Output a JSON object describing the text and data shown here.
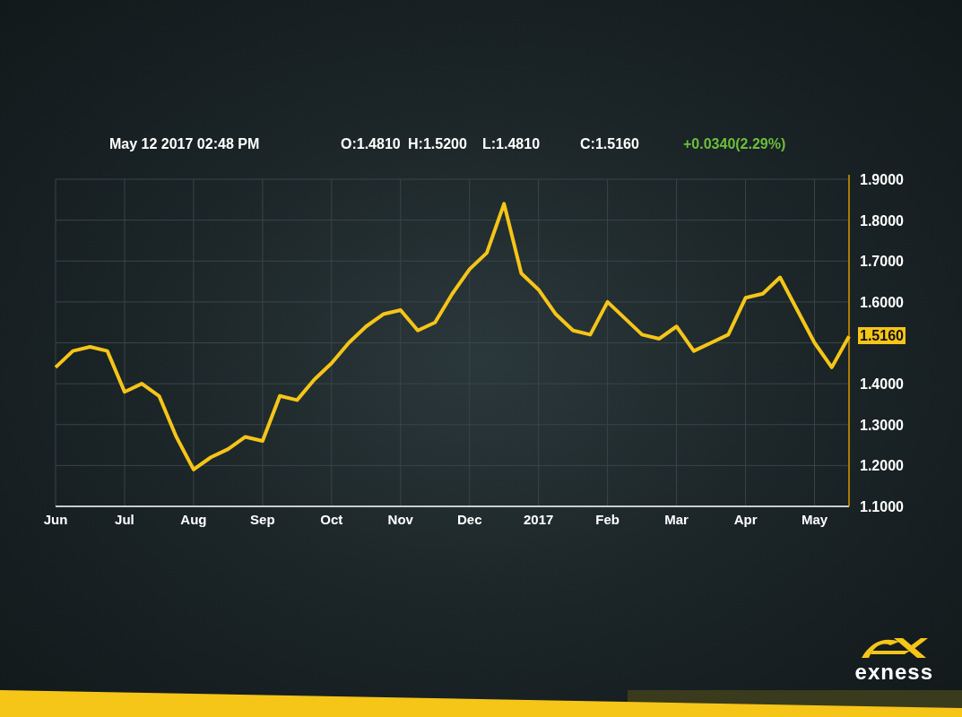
{
  "header": {
    "datetime": "May 12 2017 02:48 PM",
    "ohlc": [
      "O:1.4810",
      "H:1.5200",
      "L:1.4810",
      "C:1.5160"
    ],
    "change": "+0.0340(2.29%)"
  },
  "chart": {
    "current_price": "1.5160",
    "chart_data": {
      "type": "line",
      "categories": [
        "Jun",
        null,
        null,
        null,
        "Jul",
        null,
        null,
        null,
        "Aug",
        null,
        null,
        null,
        "Sep",
        null,
        null,
        null,
        "Oct",
        null,
        null,
        null,
        "Nov",
        null,
        null,
        null,
        "Dec",
        null,
        null,
        null,
        "2017",
        null,
        null,
        null,
        "Feb",
        null,
        null,
        null,
        "Mar",
        null,
        null,
        null,
        "Apr",
        null,
        null,
        null,
        "May",
        null,
        null
      ],
      "values": [
        1.44,
        1.48,
        1.49,
        1.48,
        1.38,
        1.4,
        1.37,
        1.27,
        1.19,
        1.22,
        1.24,
        1.27,
        1.26,
        1.37,
        1.36,
        1.41,
        1.45,
        1.5,
        1.54,
        1.57,
        1.58,
        1.53,
        1.55,
        1.62,
        1.68,
        1.72,
        1.84,
        1.67,
        1.63,
        1.57,
        1.53,
        1.52,
        1.6,
        1.56,
        1.52,
        1.51,
        1.54,
        1.48,
        1.5,
        1.52,
        1.61,
        1.62,
        1.66,
        1.58,
        1.5,
        1.44,
        1.516
      ],
      "ylim": [
        1.1,
        1.9
      ],
      "grid": true,
      "yticks": [
        {
          "value": 1.1,
          "label": "1.1000"
        },
        {
          "value": 1.2,
          "label": "1.2000"
        },
        {
          "value": 1.3,
          "label": "1.3000"
        },
        {
          "value": 1.4,
          "label": "1.4000"
        },
        {
          "value": 1.6,
          "label": "1.6000"
        },
        {
          "value": 1.7,
          "label": "1.7000"
        },
        {
          "value": 1.8,
          "label": "1.8000"
        },
        {
          "value": 1.9,
          "label": "1.9000"
        }
      ]
    }
  },
  "logo": {
    "wordmark": "exness"
  }
}
